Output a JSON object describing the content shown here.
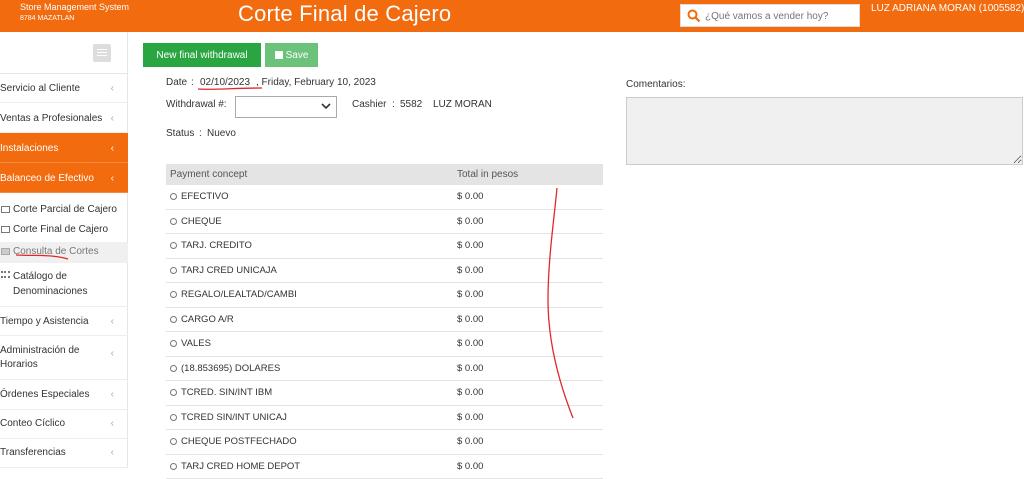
{
  "header": {
    "brand": "Store Management System",
    "store": "8784 MAZATLAN",
    "title": "Corte Final de Cajero",
    "search_placeholder": "¿Qué vamos a vender hoy?",
    "user": "LUZ ADRIANA MORAN (1005582)"
  },
  "sidebar": {
    "items": [
      {
        "label": "Servicio al Cliente",
        "chevron": "‹"
      },
      {
        "label": "Ventas a Profesionales",
        "chevron": "‹"
      },
      {
        "label": "Instalaciones",
        "chevron": "‹"
      },
      {
        "label": "Balanceo de Efectivo",
        "chevron": "‹"
      },
      {
        "label": "Tiempo y Asistencia",
        "chevron": "‹"
      },
      {
        "label": "Administración de Horarios",
        "chevron": "‹"
      },
      {
        "label": "Órdenes Especiales",
        "chevron": "‹"
      },
      {
        "label": "Conteo Cíclico",
        "chevron": "‹"
      },
      {
        "label": "Transferencias",
        "chevron": "‹"
      }
    ],
    "sub_items": [
      {
        "label": "Corte Parcial de Cajero"
      },
      {
        "label": "Corte Final de Cajero"
      },
      {
        "label": "Consulta de Cortes"
      },
      {
        "label": "Catálogo de Denominaciones"
      }
    ]
  },
  "toolbar": {
    "new_label": "New final withdrawal",
    "save_label": "Save"
  },
  "form": {
    "date_label": "Date",
    "date_value": "02/10/2023",
    "date_long": ", Friday, February 10, 2023",
    "withdrawal_label": "Withdrawal #:",
    "withdrawal_value": "",
    "cashier_label": "Cashier",
    "cashier_id": "5582",
    "cashier_name": "LUZ MORAN",
    "status_label": "Status",
    "status_value": "Nuevo",
    "comments_label": "Comentarios:",
    "separator": ":"
  },
  "table": {
    "headers": [
      "Payment concept",
      "Total in pesos"
    ],
    "rows": [
      {
        "concept": "EFECTIVO",
        "total": "$ 0.00"
      },
      {
        "concept": "CHEQUE",
        "total": "$ 0.00"
      },
      {
        "concept": "TARJ. CREDITO",
        "total": "$ 0.00"
      },
      {
        "concept": "TARJ CRED UNICAJA",
        "total": "$ 0.00"
      },
      {
        "concept": "REGALO/LEALTAD/CAMBI",
        "total": "$ 0.00"
      },
      {
        "concept": "CARGO A/R",
        "total": "$ 0.00"
      },
      {
        "concept": "VALES",
        "total": "$ 0.00"
      },
      {
        "concept": "(18.853695) DOLARES",
        "total": "$ 0.00"
      },
      {
        "concept": "TCRED. SIN/INT IBM",
        "total": "$ 0.00"
      },
      {
        "concept": "TCRED SIN/INT UNICAJ",
        "total": "$ 0.00"
      },
      {
        "concept": "CHEQUE POSTFECHADO",
        "total": "$ 0.00"
      },
      {
        "concept": "TARJ CRED HOME DEPOT",
        "total": "$ 0.00"
      }
    ]
  },
  "colors": {
    "accent": "#f26b0f",
    "green": "#29a642",
    "annotation": "#e0282a"
  }
}
